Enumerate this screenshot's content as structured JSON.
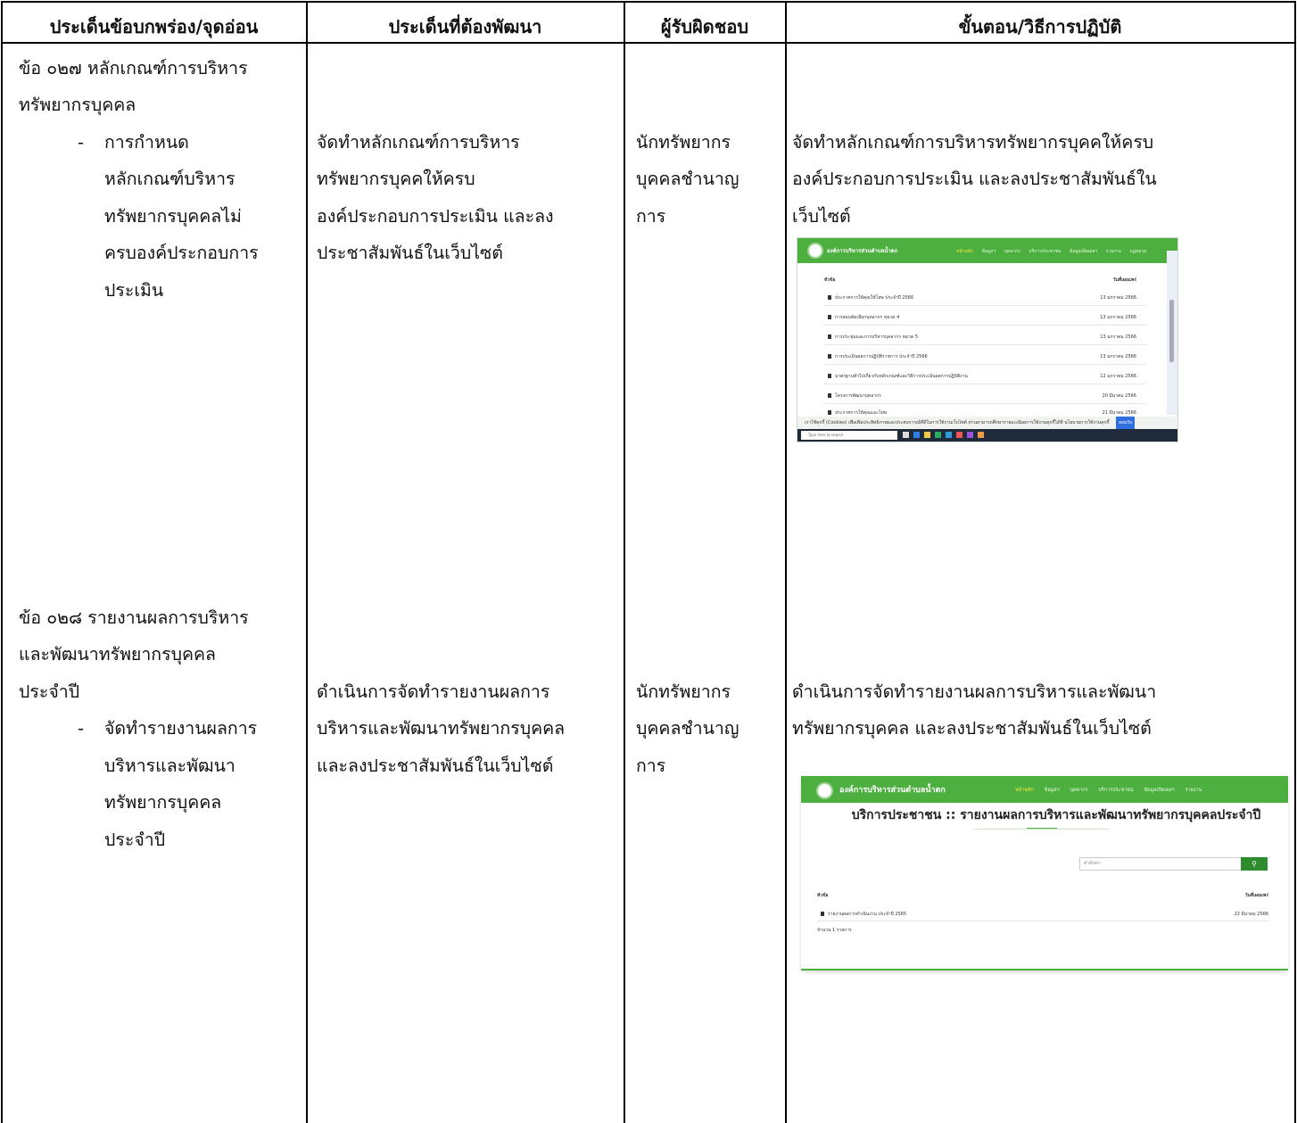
{
  "headers": {
    "col1": "ประเด็นข้อบกพร่อง/จุดอ่อน",
    "col2": "ประเด็นที่ต้องพัฒนา",
    "col3": "ผู้รับผิดชอบ",
    "col4": "ขั้นตอน/วิธีการปฏิบัติ"
  },
  "item1": {
    "issue_lines": [
      "ข้อ ๐๒๗ หลักเกณฑ์การบริหาร",
      "ทรัพยากรบุคคล"
    ],
    "dash": "-",
    "sub_lines": [
      "การกำหนด",
      "หลักเกณฑ์บริหาร",
      "ทรัพยากรบุคคลไม่",
      "ครบองค์ประกอบการ",
      "ประเมิน"
    ],
    "develop_lines": [
      "จัดทำหลักเกณฑ์การบริหาร",
      "ทรัพยากรบุคคให้ครบ",
      "องค์ประกอบการประเมิน และลง",
      "ประชาสัมพันธ์ในเว็บไซต์"
    ],
    "owner_lines": [
      "นักทรัพยากร",
      "บุคคลชำนาญ",
      "การ"
    ],
    "steps_lines": [
      "จัดทำหลักเกณฑ์การบริหารทรัพยากรบุคคให้ครบ",
      "องค์ประกอบการประเมิน และลงประชาสัมพันธ์ใน",
      "เว็บไซต์"
    ]
  },
  "item2": {
    "issue_lines": [
      "ข้อ ๐๒๘ รายงานผลการบริหาร",
      "และพัฒนาทรัพยากรบุคคล",
      "ประจำปี"
    ],
    "dash": "-",
    "sub_lines": [
      "จัดทำรายงานผลการ",
      "บริหารและพัฒนา",
      "ทรัพยากรบุคคล",
      "ประจำปี"
    ],
    "develop_lines": [
      "ดำเนินการจัดทำรายงานผลการ",
      "บริหารและพัฒนาทรัพยากรบุคคล",
      "และลงประชาสัมพันธ์ในเว็บไซต์"
    ],
    "owner_lines": [
      "นักทรัพยากร",
      "บุคคลชำนาญ",
      "การ"
    ],
    "steps_lines": [
      "ดำเนินการจัดทำรายงานผลการบริหารและพัฒนา",
      "ทรัพยากรบุคคล  และลงประชาสัมพันธ์ในเว็บไซต์"
    ]
  },
  "shot1": {
    "brand": "องค์การบริหารส่วนตำบลน้ำตก",
    "nav": [
      "หน้าหลัก",
      "ข้อมูลฯ",
      "บุคลากร",
      "บริการประชาชน",
      "ข้อมูลเปิดเผยฯ",
      "รายงาน",
      "กฎหมาย"
    ],
    "col_head": "หัวข้อ",
    "col_date": "วันที่เผยแพร่",
    "rows": [
      {
        "title": "ประกาศการให้คุณให้โทษ ประจำปี 2566",
        "date": "13 มกราคม 2566"
      },
      {
        "title": "การสอบคัดเลือกบุคลากร หมวด 4",
        "date": "13 มกราคม 2566"
      },
      {
        "title": "การประชุมและการบริหารบุคลากร หมวด 5",
        "date": "13 มกราคม 2566"
      },
      {
        "title": "การประเมินผลการปฏิบัติราชการ ประจำปี 2566",
        "date": "13 มกราคม 2566"
      },
      {
        "title": "มาตรฐานทั่วไปเกี่ยวกับหลักเกณฑ์และวิธีการประเมินผลการปฏิบัติงาน",
        "date": "12 มกราคม 2566"
      },
      {
        "title": "โครงการพัฒนาบุคลากร",
        "date": "20 มีนาคม 2566"
      },
      {
        "title": "ประกาศการให้คุณและโทษ",
        "date": "21 มีนาคม 2566"
      }
    ],
    "cookie": "เราใช้คุกกี้ (Cookies) เพื่อเพิ่มประสิทธิภาพและประสบการณ์ที่ดีในการใช้งานเว็บไซต์ ท่านสามารถศึกษารายละเอียดการใช้งานคุกกี้ได้ที่ นโยบายการใช้งานคุกกี้",
    "cookie_btn": "ยอมรับ",
    "search": "Type here to search"
  },
  "shot2": {
    "brand": "องค์การบริหารส่วนตำบลน้ำตก",
    "nav": [
      "หน้าหลัก",
      "ข้อมูลฯ",
      "บุคลากร",
      "บริการประชาชน",
      "ข้อมูลเปิดเผยฯ",
      "รายงาน"
    ],
    "heading": "บริการประชาชน :: รายงานผลการบริหารและพัฒนาทรัพยากรบุคคลประจำปี",
    "search_placeholder": "คำค้นหา",
    "col_head": "หัวข้อ",
    "col_date": "วันที่เผยแพร่",
    "row_title": "รายงานผลการดำเนินงาน ประจำปี 2565",
    "row_date": "22 มีนาคม 2566",
    "count": "จำนวน 1 รายการ"
  }
}
